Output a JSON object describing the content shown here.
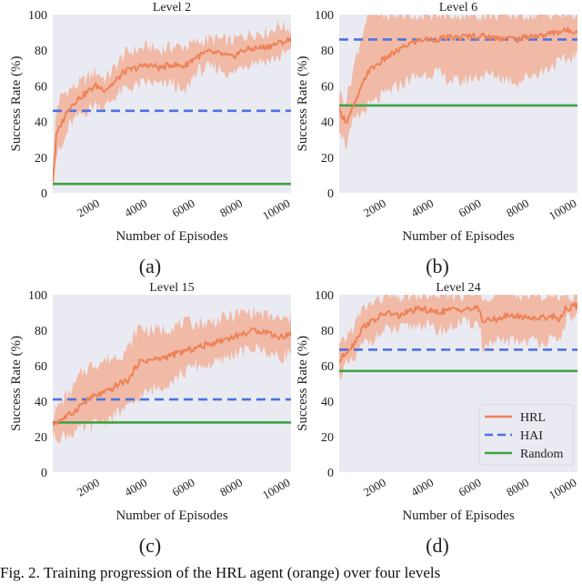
{
  "caption": "Fig. 2.  Training progression of the HRL agent (orange) over four levels",
  "colors": {
    "hrl": "#ee8257",
    "hrl_band": "#f2a98e",
    "hai": "#4c72e0",
    "random": "#3fa243",
    "plot_bg": "#eaeaf2"
  },
  "legend": {
    "placement": "lower-right of panel (d)",
    "entries": [
      {
        "label": "HRL",
        "style": "solid",
        "series": "hrl"
      },
      {
        "label": "HAI",
        "style": "dashed",
        "series": "hai"
      },
      {
        "label": "Random",
        "style": "solid",
        "series": "random"
      }
    ]
  },
  "chart_data": [
    {
      "type": "line",
      "panel_label": "(a)",
      "title": "Level 2",
      "xlabel": "Number of Episodes",
      "ylabel": "Success Rate (%)",
      "xlim": [
        0,
        10000
      ],
      "ylim": [
        0,
        100
      ],
      "xticks": [
        2000,
        4000,
        6000,
        8000,
        10000
      ],
      "yticks": [
        0,
        20,
        40,
        60,
        80,
        100
      ],
      "grid": false,
      "hai": 46,
      "random": 5,
      "hrl": {
        "x": [
          0,
          150,
          400,
          700,
          1000,
          1400,
          1800,
          2200,
          2600,
          3000,
          3500,
          4000,
          4500,
          5000,
          5500,
          6000,
          6500,
          7000,
          7500,
          8000,
          8500,
          9000,
          9500,
          10000
        ],
        "mean": [
          6,
          32,
          40,
          48,
          52,
          56,
          60,
          58,
          62,
          68,
          70,
          72,
          70,
          72,
          71,
          76,
          79,
          78,
          76,
          80,
          81,
          82,
          84,
          86
        ],
        "lower": [
          4,
          22,
          25,
          38,
          42,
          46,
          50,
          48,
          54,
          58,
          60,
          62,
          60,
          62,
          55,
          68,
          70,
          70,
          66,
          72,
          74,
          74,
          76,
          80
        ],
        "upper": [
          8,
          48,
          55,
          58,
          60,
          64,
          68,
          64,
          70,
          78,
          80,
          82,
          80,
          82,
          82,
          84,
          86,
          86,
          85,
          88,
          90,
          90,
          94,
          92
        ]
      }
    },
    {
      "type": "line",
      "panel_label": "(b)",
      "title": "Level 6",
      "xlabel": "Number of Episodes",
      "ylabel": "Success Rate (%)",
      "xlim": [
        0,
        10000
      ],
      "ylim": [
        0,
        100
      ],
      "xticks": [
        2000,
        4000,
        6000,
        8000,
        10000
      ],
      "yticks": [
        0,
        20,
        40,
        60,
        80,
        100
      ],
      "grid": false,
      "hai": 86,
      "random": 49,
      "hrl": {
        "x": [
          0,
          300,
          600,
          900,
          1200,
          1600,
          2000,
          2500,
          3000,
          3500,
          4000,
          4500,
          5000,
          5500,
          6000,
          6500,
          7000,
          7500,
          8000,
          8500,
          9000,
          9500,
          10000
        ],
        "mean": [
          46,
          40,
          48,
          58,
          68,
          72,
          76,
          80,
          84,
          86,
          86,
          87,
          87,
          88,
          88,
          87,
          87,
          86,
          88,
          88,
          90,
          91,
          91
        ],
        "lower": [
          38,
          26,
          40,
          44,
          48,
          52,
          56,
          60,
          64,
          66,
          68,
          64,
          62,
          64,
          66,
          66,
          64,
          62,
          66,
          68,
          72,
          74,
          78
        ],
        "upper": [
          56,
          52,
          70,
          86,
          100,
          100,
          100,
          100,
          100,
          100,
          100,
          100,
          100,
          100,
          100,
          100,
          100,
          100,
          100,
          100,
          100,
          100,
          100
        ]
      }
    },
    {
      "type": "line",
      "panel_label": "(c)",
      "title": "Level 15",
      "xlabel": "Number of Episodes",
      "ylabel": "Success Rate (%)",
      "xlim": [
        0,
        10000
      ],
      "ylim": [
        0,
        100
      ],
      "xticks": [
        2000,
        4000,
        6000,
        8000,
        10000
      ],
      "yticks": [
        0,
        20,
        40,
        60,
        80,
        100
      ],
      "grid": false,
      "hai": 41,
      "random": 28,
      "hrl": {
        "x": [
          0,
          400,
          800,
          1200,
          1600,
          2000,
          2400,
          2800,
          3200,
          3600,
          4000,
          4500,
          5000,
          5500,
          6000,
          6500,
          7000,
          7500,
          8000,
          8500,
          9000,
          9500,
          10000
        ],
        "mean": [
          27,
          30,
          33,
          38,
          42,
          44,
          46,
          50,
          52,
          62,
          63,
          64,
          66,
          68,
          70,
          72,
          74,
          76,
          78,
          80,
          79,
          76,
          78
        ],
        "lower": [
          20,
          20,
          22,
          24,
          26,
          28,
          30,
          34,
          36,
          42,
          45,
          48,
          52,
          56,
          60,
          60,
          62,
          66,
          68,
          70,
          68,
          64,
          68
        ],
        "upper": [
          32,
          40,
          46,
          56,
          60,
          62,
          64,
          66,
          70,
          82,
          80,
          80,
          82,
          84,
          84,
          84,
          86,
          88,
          90,
          90,
          88,
          86,
          86
        ]
      }
    },
    {
      "type": "line",
      "panel_label": "(d)",
      "title": "Level 24",
      "xlabel": "Number of Episodes",
      "ylabel": "Success Rate (%)",
      "xlim": [
        0,
        10000
      ],
      "ylim": [
        0,
        100
      ],
      "xticks": [
        2000,
        4000,
        6000,
        8000,
        10000
      ],
      "yticks": [
        0,
        20,
        40,
        60,
        80,
        100
      ],
      "grid": false,
      "hai": 69,
      "random": 57,
      "hrl": {
        "x": [
          0,
          300,
          600,
          1000,
          1500,
          2000,
          2500,
          3000,
          3500,
          4000,
          4500,
          5000,
          5500,
          5900,
          6000,
          6500,
          7000,
          7500,
          8000,
          8500,
          9000,
          9200,
          9500,
          10000
        ],
        "mean": [
          62,
          68,
          72,
          82,
          86,
          90,
          88,
          91,
          92,
          90,
          91,
          92,
          92,
          92,
          85,
          86,
          88,
          88,
          87,
          87,
          88,
          86,
          92,
          94
        ],
        "lower": [
          54,
          60,
          62,
          72,
          76,
          80,
          80,
          82,
          84,
          80,
          80,
          84,
          84,
          84,
          70,
          72,
          74,
          74,
          74,
          74,
          74,
          72,
          86,
          88
        ],
        "upper": [
          70,
          76,
          82,
          92,
          96,
          100,
          98,
          100,
          100,
          100,
          100,
          100,
          100,
          100,
          100,
          100,
          100,
          100,
          100,
          100,
          100,
          100,
          100,
          100
        ]
      }
    }
  ]
}
